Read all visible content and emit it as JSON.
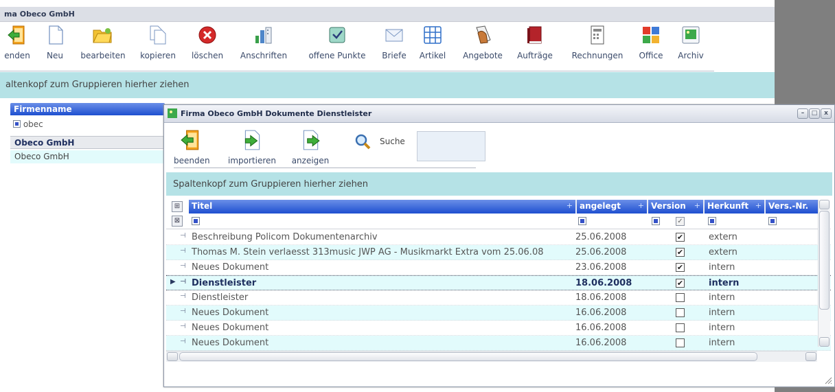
{
  "background_app": {
    "title": "ma Obeco GmbH",
    "toolbar": [
      {
        "label": "enden",
        "icon": "exit-icon"
      },
      {
        "label": "Neu",
        "icon": "new-document-icon"
      },
      {
        "label": "bearbeiten",
        "icon": "edit-folder-icon"
      },
      {
        "label": "kopieren",
        "icon": "copy-icon"
      },
      {
        "label": "löschen",
        "icon": "delete-icon"
      },
      {
        "label": "Anschriften",
        "icon": "addresses-icon"
      },
      {
        "label": "offene Punkte",
        "icon": "open-items-icon"
      },
      {
        "label": "Briefe",
        "icon": "letter-icon"
      },
      {
        "label": "Artikel",
        "icon": "article-grid-icon"
      },
      {
        "label": "Angebote",
        "icon": "offers-icon"
      },
      {
        "label": "Aufträge",
        "icon": "orders-icon"
      },
      {
        "label": "Rechnungen",
        "icon": "invoice-icon"
      },
      {
        "label": "Office",
        "icon": "office-icon"
      },
      {
        "label": "Archiv",
        "icon": "archive-icon"
      }
    ],
    "group_hint": "altenkopf zum Gruppieren hierher ziehen",
    "column_header": "Firmenname",
    "filter_value": "obec",
    "rows": [
      "Obeco GmbH",
      "Obeco GmbH"
    ]
  },
  "dialog": {
    "title": "Firma Obeco GmbH Dokumente Dienstleister",
    "toolbar": {
      "beenden": "beenden",
      "importieren": "importieren",
      "anzeigen": "anzeigen",
      "search_label": "Suche"
    },
    "group_hint": "Spaltenkopf zum Gruppieren hierher ziehen",
    "columns": {
      "titel": "Titel",
      "angelegt": "angelegt",
      "version": "Version",
      "herkunft": "Herkunft",
      "versnr": "Vers.-Nr."
    },
    "rows": [
      {
        "titel": "Beschreibung Policom Dokumentenarchiv",
        "angelegt": "25.06.2008",
        "version": "✔",
        "herkunft": "extern"
      },
      {
        "titel": "Thomas M. Stein verlaesst 313music JWP AG - Musikmarkt Extra vom 25.06.08",
        "angelegt": "25.06.2008",
        "version": "✔",
        "herkunft": "extern"
      },
      {
        "titel": "Neues Dokument",
        "angelegt": "23.06.2008",
        "version": "✔",
        "herkunft": "intern"
      },
      {
        "titel": "Dienstleister",
        "angelegt": "18.06.2008",
        "version": "✔",
        "herkunft": "intern",
        "selected": true
      },
      {
        "titel": "Dienstleister",
        "angelegt": "18.06.2008",
        "version": "",
        "herkunft": "intern"
      },
      {
        "titel": "Neues Dokument",
        "angelegt": "16.06.2008",
        "version": "",
        "herkunft": "intern"
      },
      {
        "titel": "Neues Dokument",
        "angelegt": "16.06.2008",
        "version": "",
        "herkunft": "intern"
      },
      {
        "titel": "Neues Dokument",
        "angelegt": "16.06.2008",
        "version": "",
        "herkunft": "intern"
      }
    ],
    "window_buttons": {
      "minimize": "–",
      "maximize": "□",
      "close": "x"
    }
  }
}
